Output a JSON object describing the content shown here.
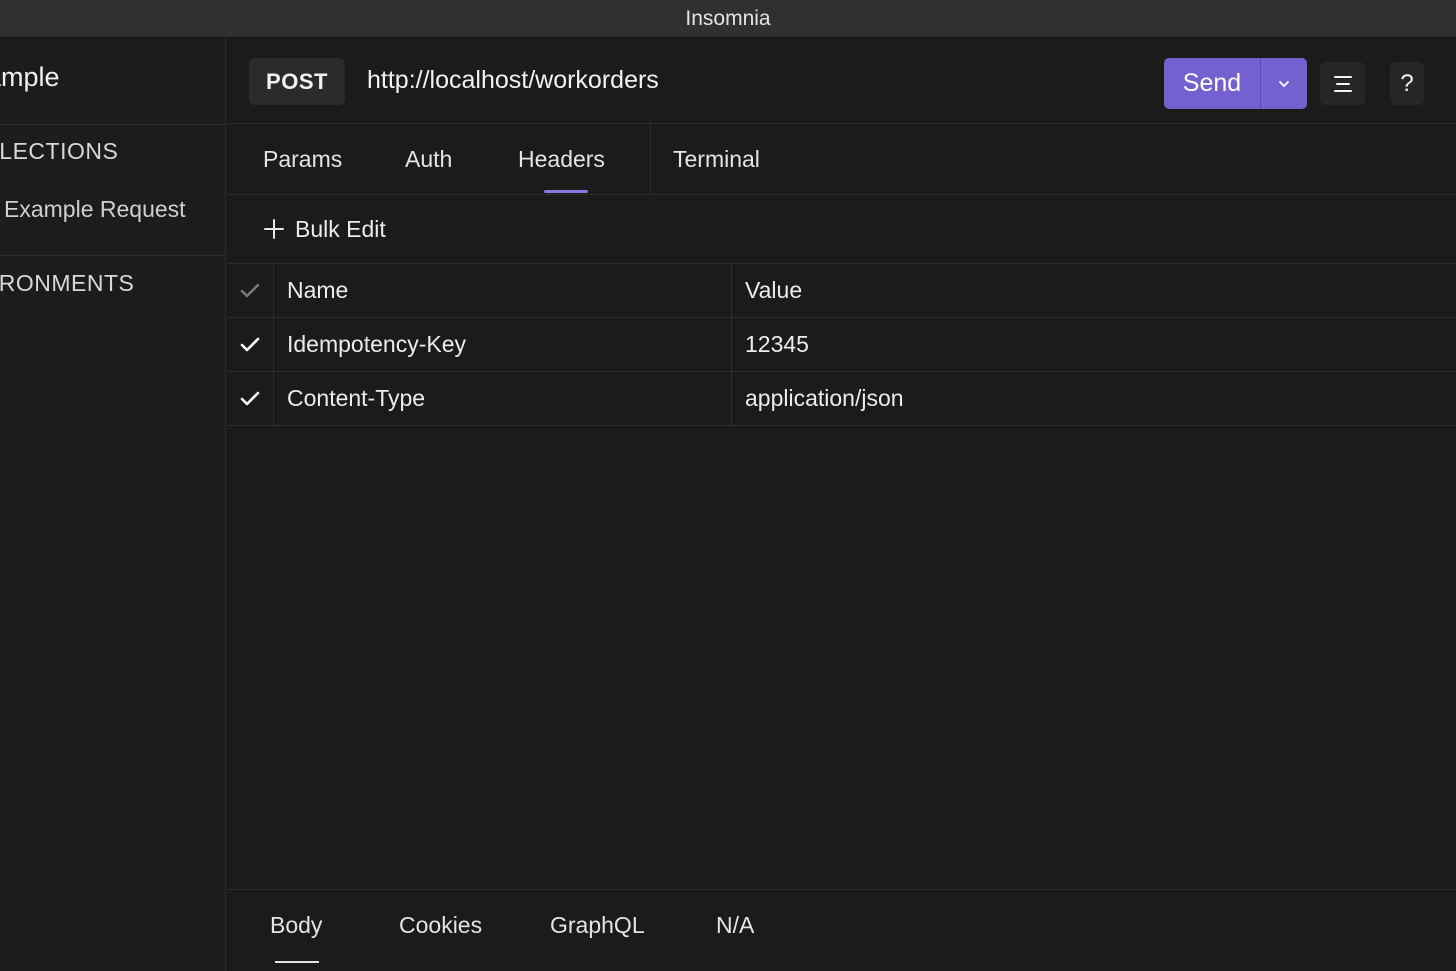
{
  "window": {
    "title": "Insomnia"
  },
  "sidebar": {
    "workspace_name": "ample",
    "collections_heading": "LLECTIONS",
    "request_item": "Example Request",
    "environments_heading": "VIRONMENTS"
  },
  "request": {
    "method": "POST",
    "url": "http://localhost/workorders",
    "send_label": "Send",
    "menu_icon": "hamburger-menu-icon",
    "help_label": "?"
  },
  "tabs": [
    {
      "label": "Params",
      "active": false
    },
    {
      "label": "Auth",
      "active": false
    },
    {
      "label": "Headers",
      "active": true
    },
    {
      "label": "Terminal",
      "active": false
    }
  ],
  "headers_panel": {
    "bulk_edit_label": "Bulk Edit",
    "columns": {
      "name": "Name",
      "value": "Value"
    },
    "rows": [
      {
        "enabled": true,
        "name": "Idempotency-Key",
        "value": "12345"
      },
      {
        "enabled": true,
        "name": "Content-Type",
        "value": "application/json"
      }
    ]
  },
  "bottom_tabs": [
    {
      "label": "Body",
      "active": true
    },
    {
      "label": "Cookies",
      "active": false
    },
    {
      "label": "GraphQL",
      "active": false
    },
    {
      "label": "N/A",
      "active": false
    }
  ],
  "colors": {
    "accent": "#7560d0",
    "tab_indicator": "#8a76e0",
    "background": "#1b1b19",
    "titlebar": "#303030"
  }
}
